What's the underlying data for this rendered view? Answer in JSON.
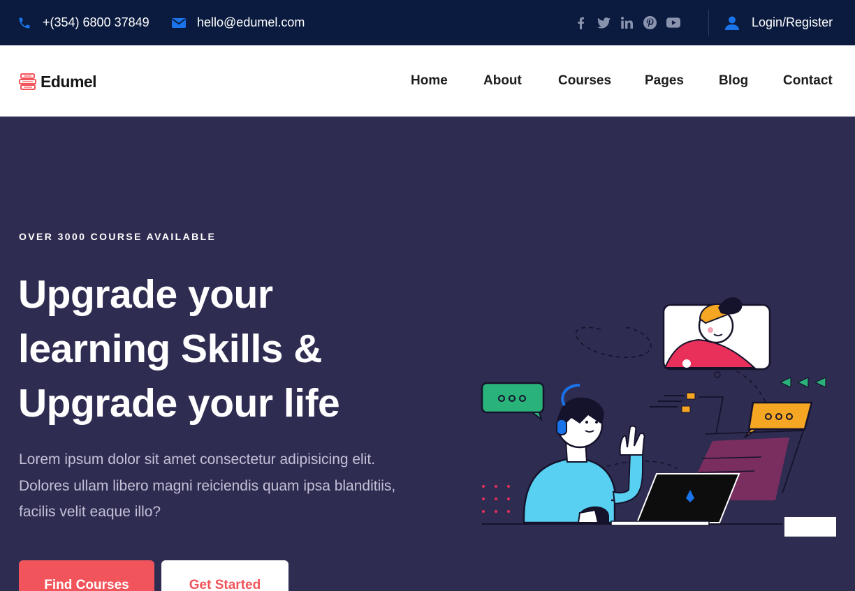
{
  "topbar": {
    "phone": "+(354) 6800 37849",
    "email": "hello@edumel.com",
    "socials": [
      "facebook-icon",
      "twitter-icon",
      "linkedin-icon",
      "pinterest-icon",
      "youtube-icon"
    ],
    "login_label": "Login/Register"
  },
  "header": {
    "logo_text": "Edumel",
    "nav": [
      "Home",
      "About",
      "Courses",
      "Pages",
      "Blog",
      "Contact"
    ]
  },
  "hero": {
    "eyebrow": "OVER 3000 COURSE AVAILABLE",
    "headline_lines": [
      "Upgrade your",
      "learning Skills &",
      "Upgrade your life"
    ],
    "lede_lines": [
      "Lorem ipsum dolor sit amet consectetur adipisicing elit.",
      "Dolores ullam libero magni reiciendis quam ipsa blanditiis,",
      "facilis velit eaque illo?"
    ],
    "primary_cta": "Find Courses",
    "secondary_cta": "Get Started"
  },
  "colors": {
    "topbar_bg": "#0b1b3f",
    "hero_bg": "#2f2c52",
    "accent": "#f2545b",
    "icon_blue": "#1a73e8"
  }
}
